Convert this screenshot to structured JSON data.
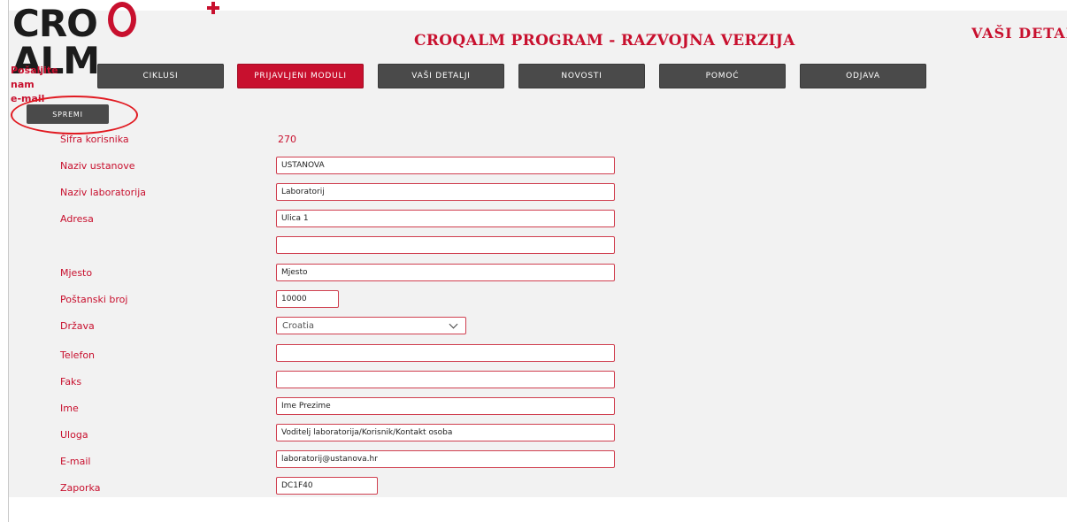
{
  "header": {
    "logo_text": "CROQALM",
    "program_title": "CROQALM PROGRAM - RAZVOJNA VERZIJA",
    "section_title": "VAŠI DETALJI"
  },
  "sidebar": {
    "email_line1": "Pošaljite nam",
    "email_line2": "e-mail"
  },
  "nav": {
    "items": [
      {
        "label": "Ciklusi",
        "active": false
      },
      {
        "label": "Prijavljeni moduli",
        "active": true
      },
      {
        "label": "Vaši detalji",
        "active": false
      },
      {
        "label": "Novosti",
        "active": false
      },
      {
        "label": "Pomoć",
        "active": false
      },
      {
        "label": "Odjava",
        "active": false
      }
    ]
  },
  "toolbar": {
    "save_label": "Spremi"
  },
  "form": {
    "user_code_label": "Šifra korisnika",
    "user_code_value": "270",
    "institution_label": "Naziv ustanove",
    "institution_value": "USTANOVA",
    "lab_label": "Naziv laboratorija",
    "lab_value": "Laboratorij",
    "address_label": "Adresa",
    "address_value": "Ulica 1",
    "address2_value": "",
    "city_label": "Mjesto",
    "city_value": "Mjesto",
    "postal_label": "Poštanski broj",
    "postal_value": "10000",
    "country_label": "Država",
    "country_value": "Croatia",
    "phone_label": "Telefon",
    "phone_value": "",
    "fax_label": "Faks",
    "fax_value": "",
    "name_label": "Ime",
    "name_value": "Ime Prezime",
    "role_label": "Uloga",
    "role_value": "Voditelj laboratorija/Korisnik/Kontakt osoba",
    "email_label": "E-mail",
    "email_value": "laboratorij@ustanova.hr",
    "password_label": "Zaporka",
    "password_value": "DC1F40"
  },
  "colors": {
    "brand_red": "#c8102e",
    "nav_gray": "#4a4a4a",
    "highlight_ring": "#e11b22"
  }
}
